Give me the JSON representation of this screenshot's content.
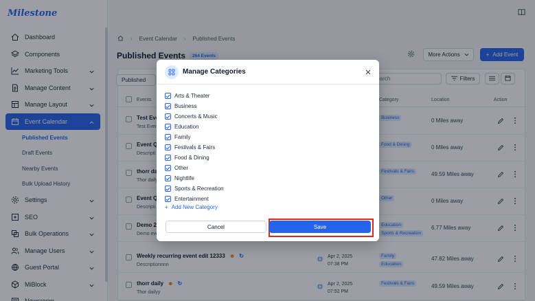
{
  "app": {
    "logo": "Milestone"
  },
  "sidebar": {
    "items": [
      {
        "label": "Dashboard",
        "icon": "home-icon"
      },
      {
        "label": "Components",
        "icon": "layers-icon"
      },
      {
        "label": "Marketing Tools",
        "icon": "chart-line-icon"
      },
      {
        "label": "Manage Content",
        "icon": "document-icon"
      },
      {
        "label": "Manage Layout",
        "icon": "layout-icon"
      },
      {
        "label": "Event Calendar",
        "icon": "calendar-icon"
      }
    ],
    "subitems": [
      "Published Events",
      "Draft Events",
      "Nearby Events",
      "Bulk Upload History"
    ],
    "items_after": [
      {
        "label": "Settings",
        "icon": "gear-icon"
      },
      {
        "label": "SEO",
        "icon": "seo-icon"
      },
      {
        "label": "Bulk Operations",
        "icon": "stack-icon"
      },
      {
        "label": "Manage Users",
        "icon": "users-icon"
      },
      {
        "label": "Guest Portal",
        "icon": "globe-icon"
      },
      {
        "label": "MiBlock",
        "icon": "cube-icon"
      },
      {
        "label": "Newsroom",
        "icon": "news-icon"
      }
    ]
  },
  "breadcrumb": {
    "item1": "Event Calendar",
    "item2": "Published Events"
  },
  "page": {
    "title": "Published Events",
    "count": "264 Events"
  },
  "toolbar": {
    "more_actions": "More Actions",
    "add_event": "Add Event",
    "tab": "Published",
    "search_placeholder": "Search",
    "filters": "Filters"
  },
  "table": {
    "headers": {
      "events": "Events",
      "category": "Category",
      "location": "Location",
      "action": "Action"
    },
    "rows": [
      {
        "title": "Test Eve",
        "sub": "Test Even",
        "date1": "",
        "date2": "",
        "categories": [
          "Business"
        ],
        "location": "0 Miles away"
      },
      {
        "title": "Event Q",
        "sub": "Descripti",
        "date1": "",
        "date2": "",
        "categories": [
          "Food & Dining"
        ],
        "location": "0 Miles away"
      },
      {
        "title": "thorr dai",
        "sub": "Thor daily",
        "date1": "",
        "date2": "",
        "categories": [
          "Festivals & Fairs"
        ],
        "location": "49.59 Miles away"
      },
      {
        "title": "Event Q",
        "sub": "Descripti",
        "date1": "",
        "date2": "",
        "categories": [
          "Other"
        ],
        "location": "0 Miles away"
      },
      {
        "title": "Demo 2",
        "sub": "Demo eve",
        "date1": "",
        "date2": "",
        "categories": [
          "Education",
          "Sports & Recreation"
        ],
        "location": "6.77 Miles away"
      },
      {
        "title": "Weekly recurring event edit 12333",
        "sub": "Descriptionnnn",
        "date1": "Apr 2, 2025",
        "date2": "07:38 PM",
        "categories": [
          "Family",
          "Education"
        ],
        "location": "47.82 Miles away"
      },
      {
        "title": "thorr daily",
        "sub": "Thor dailyy",
        "date1": "Apr 2, 2025",
        "date2": "07:52 PM",
        "categories": [
          "Festivals & Fairs"
        ],
        "location": "49.59 Miles away"
      }
    ]
  },
  "modal": {
    "title": "Manage Categories",
    "categories": [
      {
        "label": "Arts & Theater",
        "checked": true
      },
      {
        "label": "Business",
        "checked": true
      },
      {
        "label": "Concerts & Music",
        "checked": true
      },
      {
        "label": "Education",
        "checked": true
      },
      {
        "label": "Family",
        "checked": true
      },
      {
        "label": "Festivals & Fairs",
        "checked": true
      },
      {
        "label": "Food & Dining",
        "checked": true
      },
      {
        "label": "Other",
        "checked": true
      },
      {
        "label": "Nightlife",
        "checked": true
      },
      {
        "label": "Sports & Recreation",
        "checked": true
      },
      {
        "label": "Entertainment",
        "checked": true
      }
    ],
    "add_new": "Add New Category",
    "cancel": "Cancel",
    "save": "Save"
  },
  "colors": {
    "primary": "#2563eb",
    "highlight": "#dc2626",
    "badge_bg": "#dbeafe"
  }
}
